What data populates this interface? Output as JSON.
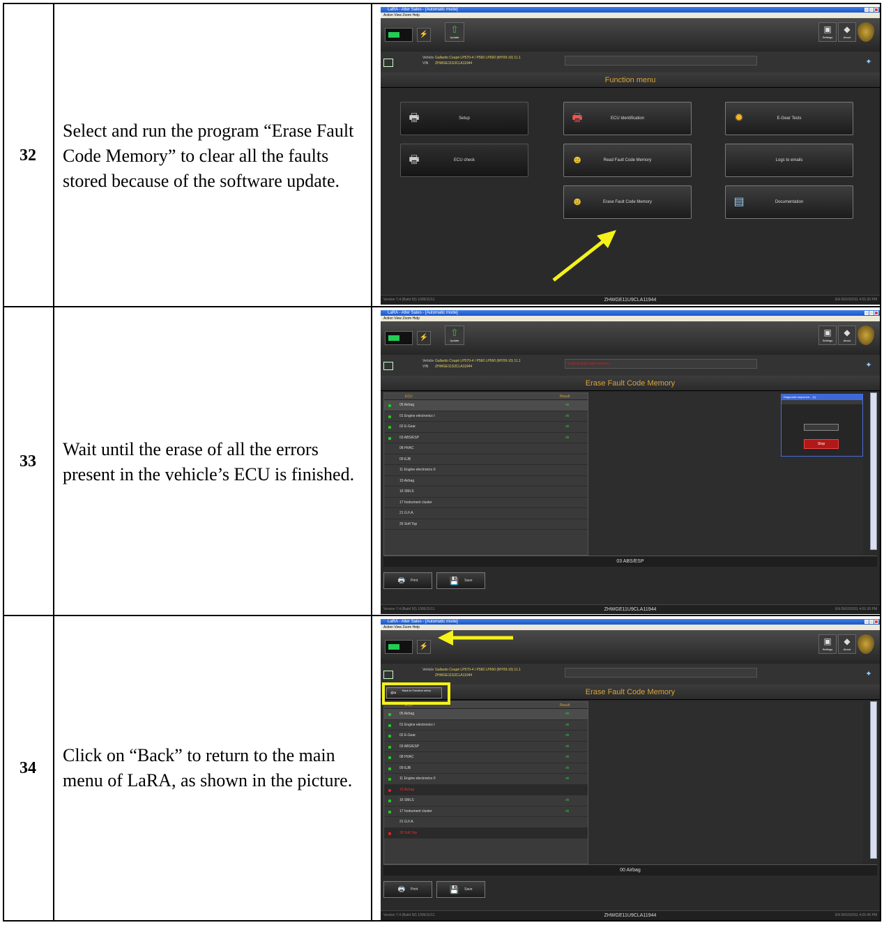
{
  "steps": [
    {
      "number": "32",
      "text": "Select and run the program “Erase Fault Code Memory” to clear all the faults stored because of the software update.",
      "screen": {
        "window_title": "LaRA - Alter Sales - [Automatic mode]",
        "menu": "Action  View  Zoom  Help",
        "section_title": "Function menu",
        "toolbar": {
          "update": "Update",
          "settings": "Settings",
          "about": "About"
        },
        "vehicle": {
          "vehicle_label": "Vehicle",
          "vehicle_value": "Gallardo Coupé LP570-4 / P560 LP560 (MY09-10) 11.1",
          "vin_label": "VIN",
          "vin_value": "ZHWGE11S3CLA11944"
        },
        "buttons": [
          {
            "label": "Setup",
            "icon": "printer-icon"
          },
          {
            "label": "ECU Identification",
            "icon": "ecu-identification-icon"
          },
          {
            "label": "E-Gear Tests",
            "icon": "gear-test-icon"
          },
          {
            "label": "ECU check",
            "icon": "printer-icon"
          },
          {
            "label": "Read Fault Code Memory",
            "icon": "read-fault-icon"
          },
          {
            "label": "Logs to emails",
            "icon": ""
          },
          {
            "label": "Erase Fault Code Memory",
            "icon": "erase-fault-icon"
          },
          {
            "label": "Documentation",
            "icon": "documentation-icon"
          }
        ],
        "status": {
          "left": "Version 7.4 (Build 50) 1005/11/11",
          "center": "ZHWGE11U9CLA11944",
          "right": "EN  09/10/2011 4:01:30 PM"
        }
      }
    },
    {
      "number": "33",
      "text": "Wait until the erase of all the errors present in the vehicle’s ECU is finished.",
      "screen": {
        "window_title": "LaRA - Alter Sales - [Automatic mode]",
        "section_title": "Erase Fault Code Memory",
        "red_status": "Erasing fault code memory...",
        "list_header": {
          "ecu": "ECU",
          "result": "Result"
        },
        "ecus": [
          {
            "name": "05 Airbag",
            "state": "ok"
          },
          {
            "name": "01 Engine electronics I",
            "state": "ok"
          },
          {
            "name": "02 E-Gear",
            "state": "ok"
          },
          {
            "name": "03 ABS/ESP",
            "state": "ok"
          },
          {
            "name": "08 HVAC",
            "state": ""
          },
          {
            "name": "09 EJB",
            "state": ""
          },
          {
            "name": "11 Engine electronics II",
            "state": ""
          },
          {
            "name": "15 Airbag",
            "state": ""
          },
          {
            "name": "16 SMLS",
            "state": ""
          },
          {
            "name": "17 Instrument cluster",
            "state": ""
          },
          {
            "name": "21 G.F.A.",
            "state": ""
          },
          {
            "name": "26 Soft Top",
            "state": ""
          }
        ],
        "ok_text": "ok",
        "info": "03 ABS/ESP",
        "dialog_title": "Diagnostic sequence... (1)",
        "dialog_stop": "Stop",
        "print_label": "Print",
        "save_label": "Save",
        "status": {
          "left": "Version 7.4 (Build 50) 1005/11/11",
          "center": "ZHWGE11U9CLA11944",
          "right": "EN  09/10/2011 4:01:30 PM"
        }
      }
    },
    {
      "number": "34",
      "text": "Click on “Back” to return to the main menu of LaRA, as shown in the picture.",
      "screen": {
        "window_title": "LaRA - Alter Sales - [Automatic mode]",
        "menu": "Action  View  Zoom  Help",
        "section_title": "Erase Fault Code Memory",
        "back_label": "Back to Function menu",
        "list_header": {
          "ecu": "ECU",
          "result": "Result"
        },
        "ecus": [
          {
            "name": "05 Airbag",
            "state": "ok"
          },
          {
            "name": "01 Engine electronics I",
            "state": "ok"
          },
          {
            "name": "02 E-Gear",
            "state": "ok"
          },
          {
            "name": "03 ABS/ESP",
            "state": "ok"
          },
          {
            "name": "08 HVAC",
            "state": "ok"
          },
          {
            "name": "09 EJB",
            "state": "ok"
          },
          {
            "name": "11 Engine electronics II",
            "state": "ok"
          },
          {
            "name": "15 Airbag",
            "state": "error"
          },
          {
            "name": "16 SMLS",
            "state": "ok"
          },
          {
            "name": "17 Instrument cluster",
            "state": "ok"
          },
          {
            "name": "21 G.F.A.",
            "state": ""
          },
          {
            "name": "26 Soft Top",
            "state": "error"
          }
        ],
        "ok_text": "ok",
        "info": "00 Airbag",
        "print_label": "Print",
        "save_label": "Save",
        "status": {
          "left": "Version 7.4 (Build 50) 1005/11/11",
          "center": "ZHWGE11U9CLA11944",
          "right": "EN  09/10/2011 4:01:45 PM"
        }
      }
    }
  ],
  "colors": {
    "highlight": "#f5f21a",
    "section_title": "#d9a53a",
    "ok_green": "#33cc33",
    "error_red": "#dd2222"
  }
}
